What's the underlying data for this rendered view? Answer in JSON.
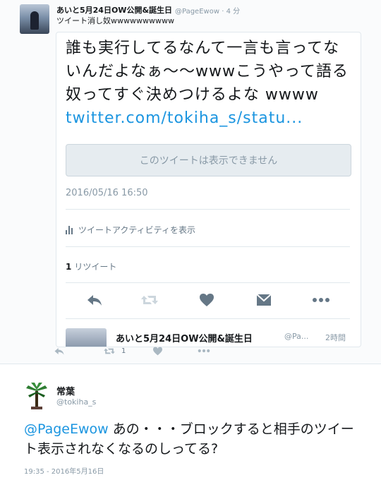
{
  "tweet": {
    "author_name": "あいと5月24日OW公開&誕生日",
    "author_handle": "@PageEwow",
    "time_ago": "4 分",
    "text": "ツイート消し奴wwwwwwwwww"
  },
  "quoted": {
    "text": "誰も実行してるなんて一言も言ってないんだよなぁ〜〜wwwこうやって語る奴ってすぐ決めつけるよな wwww ",
    "link": "twitter.com/tokiha_s/statu...",
    "withheld_notice": "このツイートは表示できません",
    "date": "2016/05/16 16:50",
    "activity_label": "ツイートアクティビティを表示",
    "retweet_count": "1",
    "retweet_label": "リツイート",
    "icons": [
      "reply-icon",
      "retweet-icon",
      "like-icon",
      "dm-icon",
      "more-icon"
    ],
    "reply_author_name": "あいと5月24日OW公開&誕生日",
    "reply_author_handle": "@Pa...",
    "reply_time": "2時間"
  },
  "outer_actions": {
    "retweet_count": "1",
    "icons": [
      "reply-icon",
      "retweet-icon",
      "like-icon",
      "more-icon"
    ]
  },
  "bottom_tweet": {
    "author_name": "常葉",
    "author_handle": "@tokiha_s",
    "mention": "@PageEwow",
    "text": " あの・・・ブロックすると相手のツイート表示されなくなるのしってる?",
    "timestamp": "19:35 - 2016年5月16日"
  },
  "colors": {
    "link": "#1b95e0",
    "muted": "#8899a6",
    "icon": "#657786",
    "border": "#e1e8ed"
  }
}
